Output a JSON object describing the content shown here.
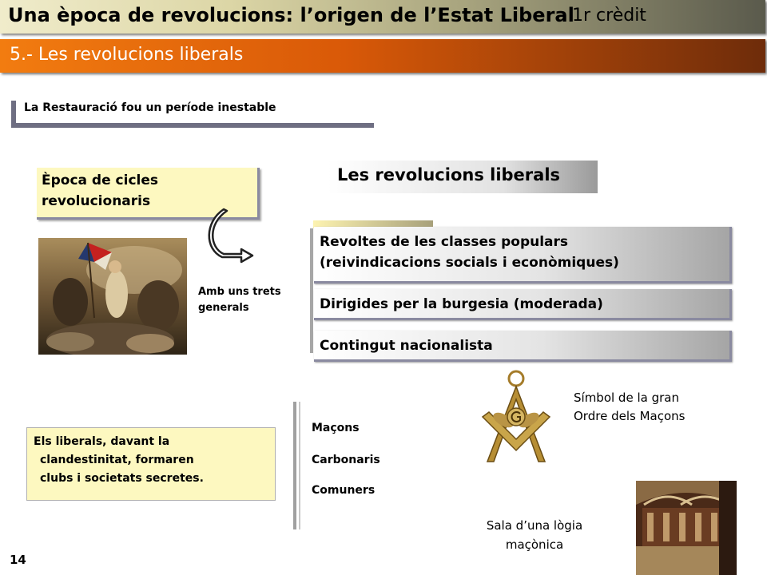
{
  "header": {
    "title": "Una època de revolucions: l’origen de l’Estat Liberal",
    "credit": "1r crèdit"
  },
  "section": {
    "title": "5.- Les revolucions liberals"
  },
  "subtitle": "La Restauració fou un període inestable",
  "epoca_box": {
    "line1": "Època de cicles",
    "line2": "revolucionaris"
  },
  "heading": "Les revolucions liberals",
  "traits_label": {
    "line1": "Amb uns trets",
    "line2": "generals"
  },
  "list": [
    {
      "line1": "Revoltes de les classes populars",
      "line2": "(reivindicacions socials i econòmiques)"
    },
    {
      "line1": "Dirigides per la burgesia (moderada)"
    },
    {
      "line1": "Contingut nacionalista"
    }
  ],
  "liberals_box": {
    "line1": "Els liberals, davant la",
    "line2": "clandestinitat, formaren",
    "line3": "clubs i societats secretes."
  },
  "societies": [
    "Maçons",
    "Carbonaris",
    "Comuners"
  ],
  "symbol_caption": {
    "line1": "Símbol de la gran",
    "line2": "Ordre dels Maçons"
  },
  "hall_caption": {
    "line1": "Sala d’una lògia",
    "line2": "maçònica"
  },
  "page_number": "14",
  "colors": {
    "section_bar": "#d95908",
    "note_box": "#fdf8c0",
    "title_bar": "#dcd6a6"
  }
}
